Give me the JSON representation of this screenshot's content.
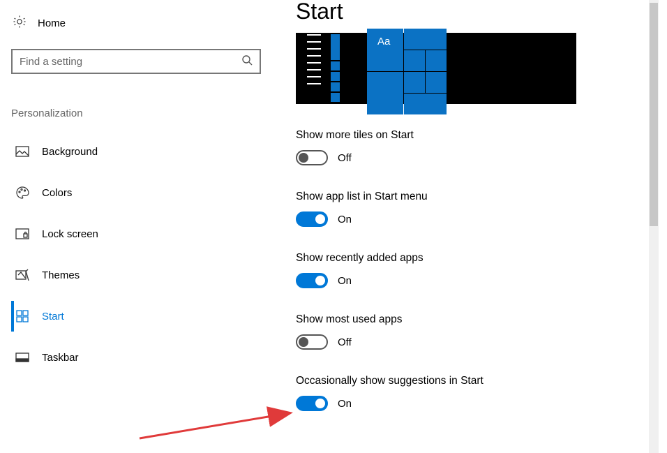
{
  "sidebar": {
    "home_label": "Home",
    "search_placeholder": "Find a setting",
    "section_label": "Personalization",
    "items": [
      {
        "label": "Background",
        "icon": "image-icon",
        "active": false
      },
      {
        "label": "Colors",
        "icon": "palette-icon",
        "active": false
      },
      {
        "label": "Lock screen",
        "icon": "lock-screen-icon",
        "active": false
      },
      {
        "label": "Themes",
        "icon": "themes-icon",
        "active": false
      },
      {
        "label": "Start",
        "icon": "start-icon",
        "active": true
      },
      {
        "label": "Taskbar",
        "icon": "taskbar-icon",
        "active": false
      }
    ]
  },
  "main": {
    "title": "Start",
    "preview_tile_label": "Aa",
    "settings": [
      {
        "label": "Show more tiles on Start",
        "state": "Off",
        "on": false
      },
      {
        "label": "Show app list in Start menu",
        "state": "On",
        "on": true
      },
      {
        "label": "Show recently added apps",
        "state": "On",
        "on": true
      },
      {
        "label": "Show most used apps",
        "state": "Off",
        "on": false
      },
      {
        "label": "Occasionally show suggestions in Start",
        "state": "On",
        "on": true
      }
    ]
  }
}
